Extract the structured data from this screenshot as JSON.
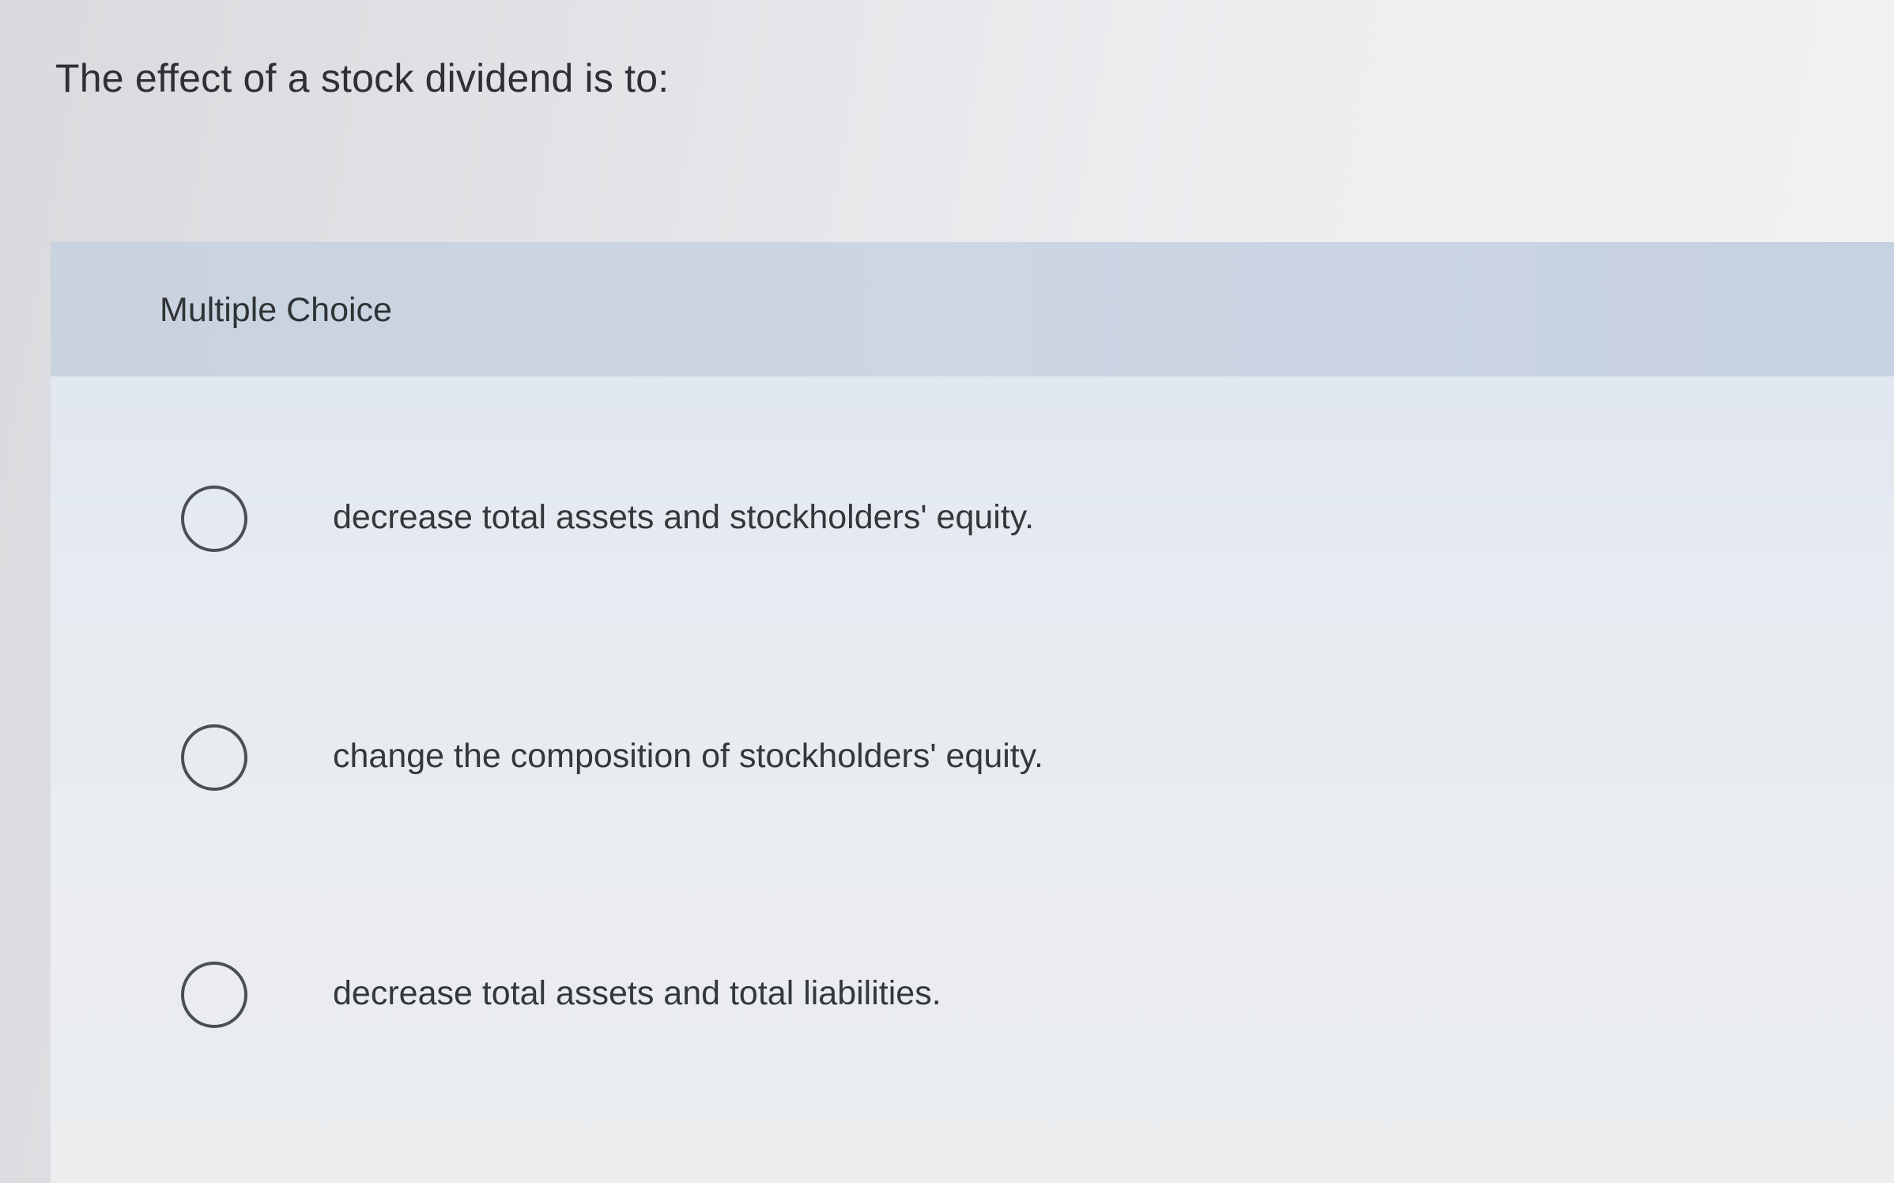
{
  "question": {
    "text": "The effect of a stock dividend is to:"
  },
  "panel": {
    "label": "Multiple Choice",
    "options": [
      {
        "text": "decrease total assets and stockholders' equity.",
        "selected": false
      },
      {
        "text": "change the composition of stockholders' equity.",
        "selected": false
      },
      {
        "text": "decrease total assets and total liabilities.",
        "selected": false
      }
    ]
  },
  "colors": {
    "header_band": "#cbd4e1",
    "panel_body": "#e6eaf0",
    "text": "#2e3033",
    "radio_border": "#4a4e55"
  },
  "icons": {
    "radio": "radio-button-unselected-icon"
  }
}
